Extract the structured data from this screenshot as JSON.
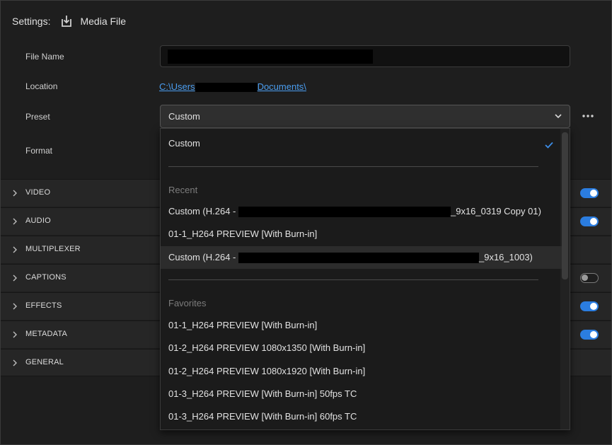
{
  "header": {
    "settings_label": "Settings:",
    "destination": "Media File"
  },
  "fields": {
    "file_name_label": "File Name",
    "location_label": "Location",
    "location_prefix": "C:\\Users",
    "location_suffix": "Documents\\",
    "preset_label": "Preset",
    "preset_value": "Custom",
    "format_label": "Format"
  },
  "sections": [
    {
      "label": "VIDEO",
      "toggle": "on"
    },
    {
      "label": "AUDIO",
      "toggle": "on"
    },
    {
      "label": "MULTIPLEXER",
      "toggle": "none"
    },
    {
      "label": "CAPTIONS",
      "toggle": "off"
    },
    {
      "label": "EFFECTS",
      "toggle": "on"
    },
    {
      "label": "METADATA",
      "toggle": "on"
    },
    {
      "label": "GENERAL",
      "toggle": "none"
    }
  ],
  "dropdown": {
    "selected": "Custom",
    "recent_header": "Recent",
    "recent": [
      {
        "prefix": "Custom (H.264 - ",
        "suffix": "_9x16_0319 Copy 01)"
      },
      {
        "text": "01-1_H264 PREVIEW [With Burn-in]"
      },
      {
        "prefix": "Custom (H.264 - ",
        "suffix": "_9x16_1003)"
      }
    ],
    "favorites_header": "Favorites",
    "favorites": [
      "01-1_H264 PREVIEW [With Burn-in]",
      "01-2_H264 PREVIEW 1080x1350 [With Burn-in]",
      "01-2_H264 PREVIEW 1080x1920 [With Burn-in]",
      "01-3_H264 PREVIEW [With Burn-in] 50fps TC",
      "01-3_H264 PREVIEW [With Burn-in] 60fps TC"
    ]
  },
  "colors": {
    "accent": "#2b7de0",
    "link": "#4a9df0",
    "background": "#1e1e1e"
  }
}
